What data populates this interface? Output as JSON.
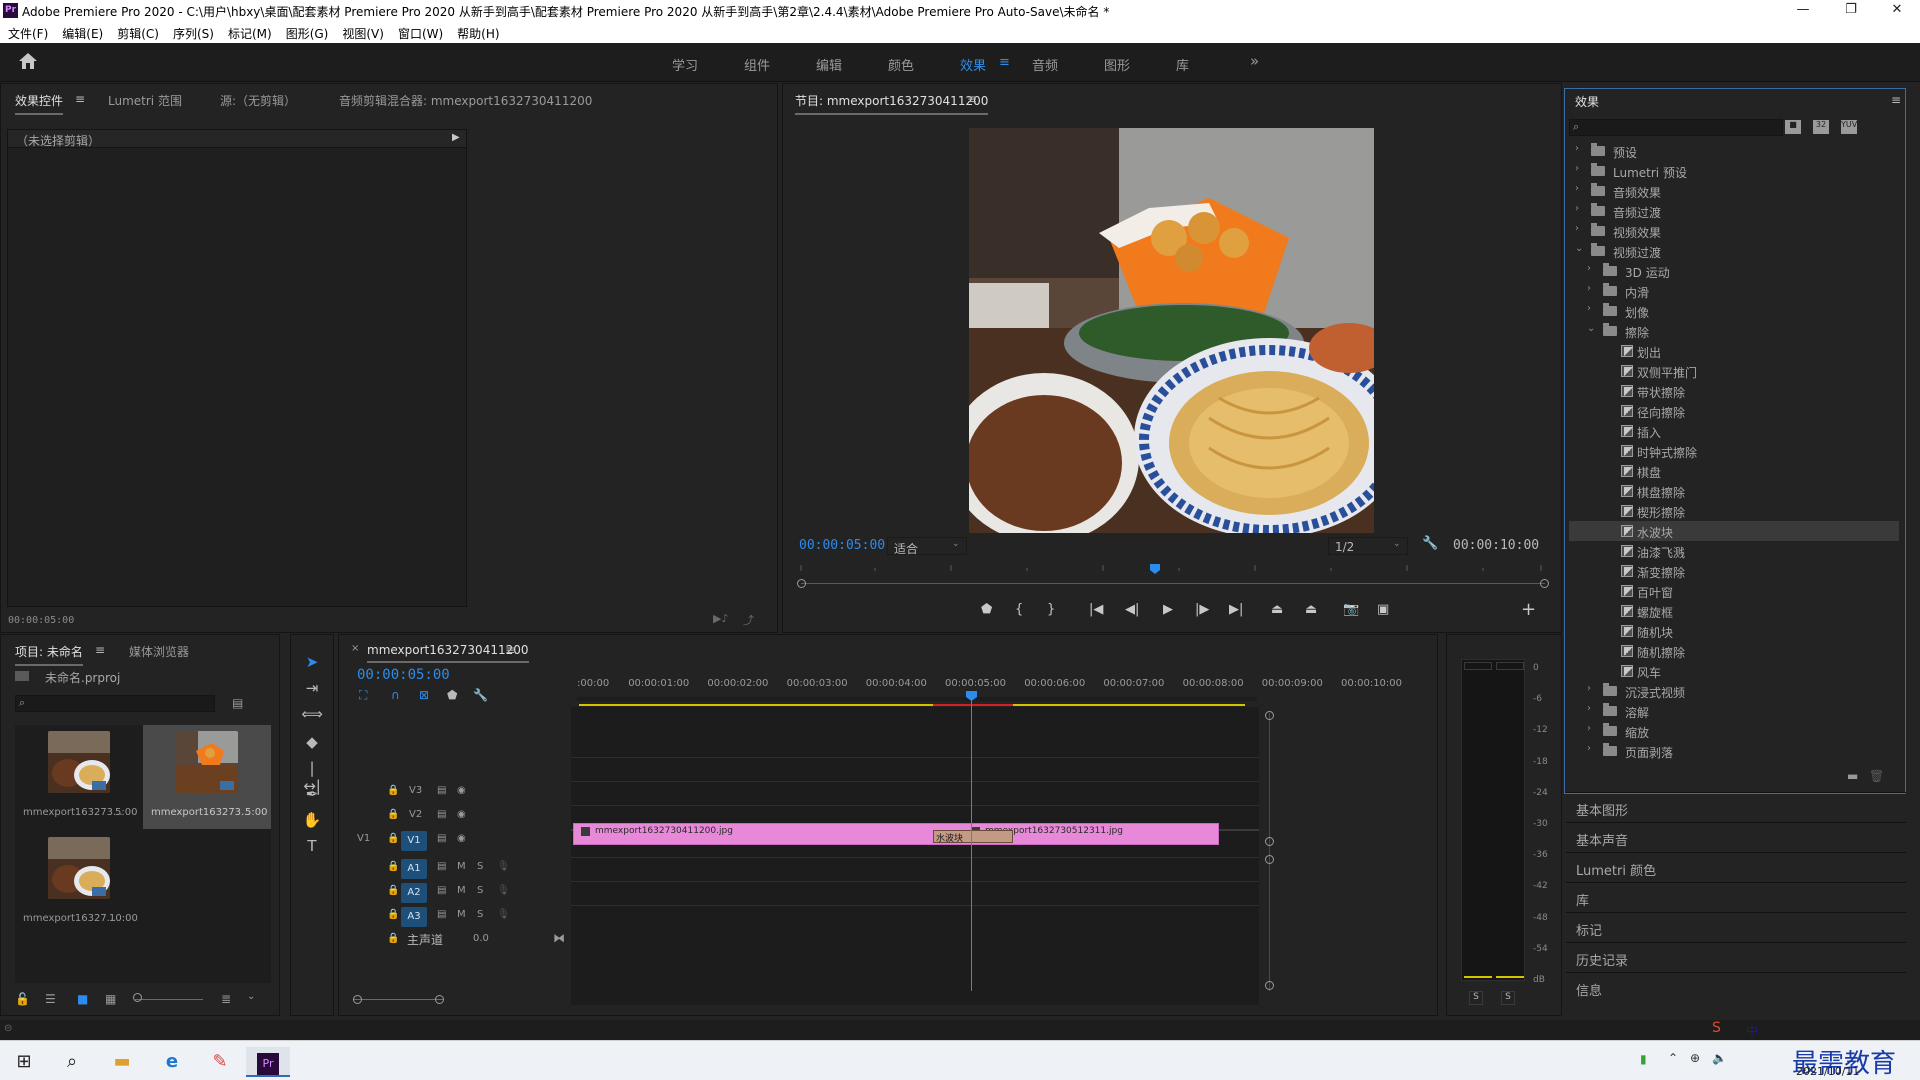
{
  "window": {
    "title": "Adobe Premiere Pro 2020 - C:\\用户\\hbxy\\桌面\\配套素材 Premiere Pro 2020 从新手到高手\\配套素材 Premiere Pro 2020 从新手到高手\\第2章\\2.4.4\\素材\\Adobe Premiere Pro Auto-Save\\未命名 *",
    "minimize": "—",
    "maximize": "❐",
    "close": "✕",
    "app_icon": "Pr"
  },
  "menu": [
    "文件(F)",
    "编辑(E)",
    "剪辑(C)",
    "序列(S)",
    "标记(M)",
    "图形(G)",
    "视图(V)",
    "窗口(W)",
    "帮助(H)"
  ],
  "workspaces": [
    "学习",
    "组件",
    "编辑",
    "颜色",
    "效果",
    "音频",
    "图形",
    "库"
  ],
  "workspace_active": "效果",
  "workspace_more": "»",
  "source_panel": {
    "tabs": [
      "效果控件",
      "Lumetri 范围",
      "源:（无剪辑）",
      "音频剪辑混合器: mmexport1632730411200"
    ],
    "no_clip": "（未选择剪辑）",
    "timecode": "00:00:05:00"
  },
  "program": {
    "tab": "节目: mmexport1632730411200",
    "timecode": "00:00:05:00",
    "fit": "适合",
    "resolution": "1/2",
    "duration": "00:00:10:00"
  },
  "project": {
    "tabs": [
      "项目: 未命名",
      "媒体浏览器"
    ],
    "file": "未命名.prproj",
    "items": [
      {
        "name": "mmexport163273...",
        "dur": "5:00"
      },
      {
        "name": "mmexport163273...",
        "dur": "5:00"
      },
      {
        "name": "mmexport16327...",
        "dur": "10:00"
      }
    ]
  },
  "timeline": {
    "tab": "mmexport1632730411200",
    "timecode": "00:00:05:00",
    "ticks": [
      ":00:00",
      "00:00:01:00",
      "00:00:02:00",
      "00:00:03:00",
      "00:00:04:00",
      "00:00:05:00",
      "00:00:06:00",
      "00:00:07:00",
      "00:00:08:00",
      "00:00:09:00",
      "00:00:10:00"
    ],
    "video_tracks": [
      "V3",
      "V2",
      "V1"
    ],
    "audio_tracks": [
      "A1",
      "A2",
      "A3"
    ],
    "source_patch": "V1",
    "master": "主声道",
    "master_value": "0.0",
    "clip1": "mmexport1632730411200.jpg",
    "clip2": "mmexport1632730512311.jpg",
    "transition": "水波块",
    "m": "M",
    "s": "S"
  },
  "meter": {
    "scale": [
      "0",
      "-6",
      "-12",
      "-18",
      "-24",
      "-30",
      "-36",
      "-42",
      "-48",
      "-54",
      "dB"
    ],
    "s1": "S",
    "s2": "S"
  },
  "effects": {
    "title": "效果",
    "tree": [
      {
        "label": "预设",
        "level": 0,
        "kind": "folder",
        "open": false
      },
      {
        "label": "Lumetri 预设",
        "level": 0,
        "kind": "folder",
        "open": false
      },
      {
        "label": "音频效果",
        "level": 0,
        "kind": "folder",
        "open": false
      },
      {
        "label": "音频过渡",
        "level": 0,
        "kind": "folder",
        "open": false
      },
      {
        "label": "视频效果",
        "level": 0,
        "kind": "folder",
        "open": false
      },
      {
        "label": "视频过渡",
        "level": 0,
        "kind": "folder",
        "open": true
      },
      {
        "label": "3D 运动",
        "level": 1,
        "kind": "folder",
        "open": false
      },
      {
        "label": "内滑",
        "level": 1,
        "kind": "folder",
        "open": false
      },
      {
        "label": "划像",
        "level": 1,
        "kind": "folder",
        "open": false
      },
      {
        "label": "擦除",
        "level": 1,
        "kind": "folder",
        "open": true
      },
      {
        "label": "划出",
        "level": 2,
        "kind": "fx"
      },
      {
        "label": "双侧平推门",
        "level": 2,
        "kind": "fx"
      },
      {
        "label": "带状擦除",
        "level": 2,
        "kind": "fx"
      },
      {
        "label": "径向擦除",
        "level": 2,
        "kind": "fx"
      },
      {
        "label": "插入",
        "level": 2,
        "kind": "fx"
      },
      {
        "label": "时钟式擦除",
        "level": 2,
        "kind": "fx"
      },
      {
        "label": "棋盘",
        "level": 2,
        "kind": "fx"
      },
      {
        "label": "棋盘擦除",
        "level": 2,
        "kind": "fx"
      },
      {
        "label": "楔形擦除",
        "level": 2,
        "kind": "fx"
      },
      {
        "label": "水波块",
        "level": 2,
        "kind": "fx",
        "selected": true
      },
      {
        "label": "油漆飞溅",
        "level": 2,
        "kind": "fx"
      },
      {
        "label": "渐变擦除",
        "level": 2,
        "kind": "fx"
      },
      {
        "label": "百叶窗",
        "level": 2,
        "kind": "fx"
      },
      {
        "label": "螺旋框",
        "level": 2,
        "kind": "fx"
      },
      {
        "label": "随机块",
        "level": 2,
        "kind": "fx"
      },
      {
        "label": "随机擦除",
        "level": 2,
        "kind": "fx"
      },
      {
        "label": "风车",
        "level": 2,
        "kind": "fx"
      },
      {
        "label": "沉浸式视频",
        "level": 1,
        "kind": "folder",
        "open": false
      },
      {
        "label": "溶解",
        "level": 1,
        "kind": "folder",
        "open": false
      },
      {
        "label": "缩放",
        "level": 1,
        "kind": "folder",
        "open": false
      },
      {
        "label": "页面剥落",
        "level": 1,
        "kind": "folder",
        "open": false
      }
    ]
  },
  "side_panels": [
    "基本图形",
    "基本声音",
    "Lumetri 颜色",
    "库",
    "标记",
    "历史记录",
    "信息"
  ],
  "taskbar": {
    "date": "2021/10/11",
    "ime": "中",
    "watermark": "最需教育"
  }
}
